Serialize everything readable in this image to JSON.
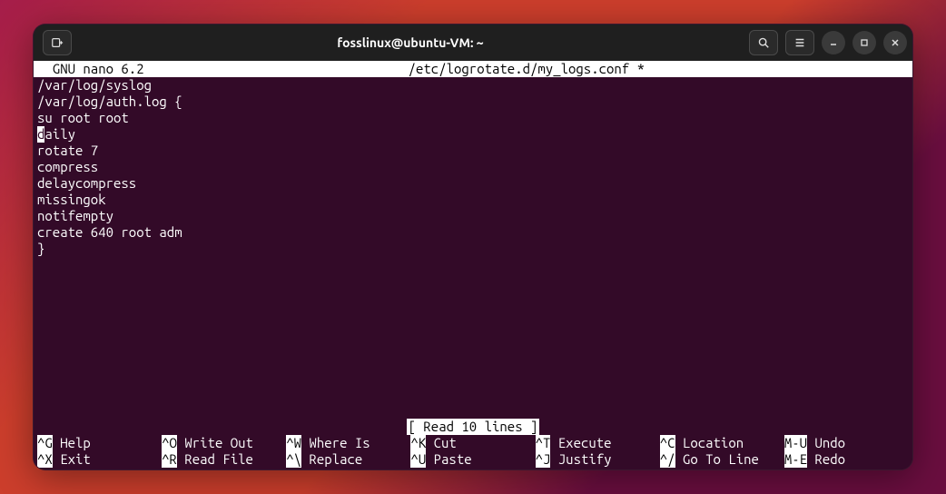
{
  "window": {
    "title": "fosslinux@ubuntu-VM: ~"
  },
  "nano": {
    "app": "  GNU nano 6.2",
    "filename": "/etc/logrotate.d/my_logs.conf *",
    "lines": [
      "/var/log/syslog",
      "/var/log/auth.log {",
      "su root root",
      "daily",
      "rotate 7",
      "compress",
      "delaycompress",
      "missingok",
      "notifempty",
      "create 640 root adm",
      "}"
    ],
    "cursor": {
      "line": 3,
      "col": 0
    },
    "status": "[ Read 10 lines ]",
    "shortcuts": [
      {
        "key": "^G",
        "label": " Help"
      },
      {
        "key": "^O",
        "label": " Write Out"
      },
      {
        "key": "^W",
        "label": " Where Is"
      },
      {
        "key": "^K",
        "label": " Cut"
      },
      {
        "key": "^T",
        "label": " Execute"
      },
      {
        "key": "^C",
        "label": " Location"
      },
      {
        "key": "M-U",
        "label": " Undo"
      },
      {
        "key": "^X",
        "label": " Exit"
      },
      {
        "key": "^R",
        "label": " Read File"
      },
      {
        "key": "^\\",
        "label": " Replace"
      },
      {
        "key": "^U",
        "label": " Paste"
      },
      {
        "key": "^J",
        "label": " Justify"
      },
      {
        "key": "^/",
        "label": " Go To Line"
      },
      {
        "key": "M-E",
        "label": " Redo"
      }
    ]
  }
}
